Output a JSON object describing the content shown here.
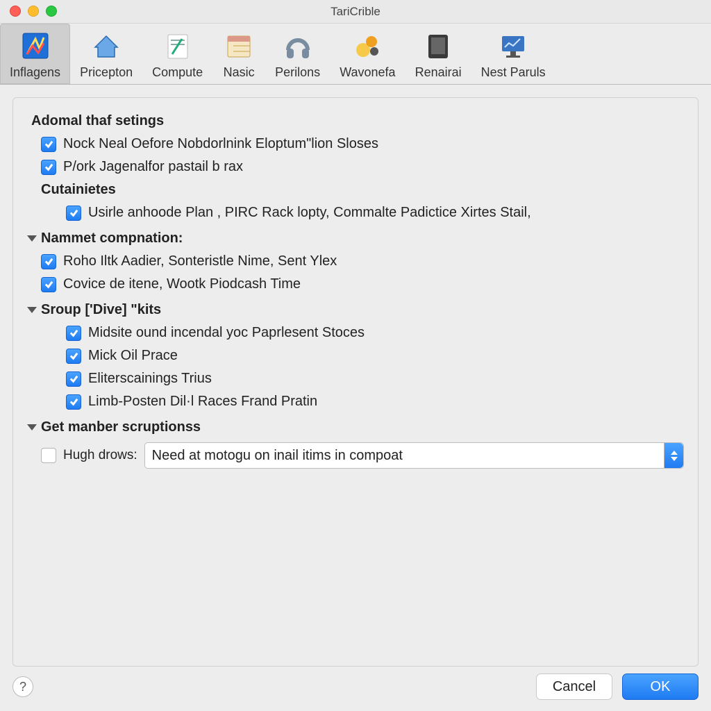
{
  "window": {
    "title": "TariCrible"
  },
  "toolbar": {
    "tabs": [
      {
        "label": "Inflagens",
        "selected": true,
        "icon": "paint-icon"
      },
      {
        "label": "Pricepton",
        "selected": false,
        "icon": "house-icon"
      },
      {
        "label": "Compute",
        "selected": false,
        "icon": "note-icon"
      },
      {
        "label": "Nasic",
        "selected": false,
        "icon": "calendar-icon"
      },
      {
        "label": "Perilons",
        "selected": false,
        "icon": "headset-icon"
      },
      {
        "label": "Wavonefa",
        "selected": false,
        "icon": "colorballs-icon"
      },
      {
        "label": "Renairai",
        "selected": false,
        "icon": "tablet-icon"
      },
      {
        "label": "Nest Paruls",
        "selected": false,
        "icon": "monitor-icon"
      }
    ]
  },
  "sections": {
    "adomal": {
      "title": "Adomal thaf setings",
      "items": [
        {
          "label": "Nock Neal Oefore Nobdorlnink Eloptum\"lion Sloses",
          "checked": true
        },
        {
          "label": "P/ork Jagenalfor pastail b rax",
          "checked": true
        }
      ]
    },
    "cutainietes": {
      "title": "Cutainietes",
      "items": [
        {
          "label": "Usirle anhoode Plan , PIRC Rack lopty, Commalte Padictice Xirtes Stail,",
          "checked": true
        }
      ]
    },
    "nammet": {
      "title": "Nammet compnation:",
      "items": [
        {
          "label": "Roho Iltk Aadier, Sonteristle Nime, Sent Ylex",
          "checked": true
        },
        {
          "label": "Covice de itene, Wootk Piodcash Time",
          "checked": true
        }
      ]
    },
    "sroup": {
      "title": "Sroup ['Dive] \"kits",
      "items": [
        {
          "label": "Midsite ound incendal yoc Paprlesent Stoces",
          "checked": true
        },
        {
          "label": "Mick Oil Prace",
          "checked": true
        },
        {
          "label": "Eliterscainings Trius",
          "checked": true
        },
        {
          "label": "Limb-Posten Dil·l Races Frand Pratin",
          "checked": true
        }
      ]
    },
    "getmanber": {
      "title": "Get manber scruptionss",
      "dropdown": {
        "label": "Hugh drows:",
        "checked": false,
        "value": "Need at motogu on inail itims in compoat"
      }
    }
  },
  "footer": {
    "help": "?",
    "cancel": "Cancel",
    "ok": "OK"
  }
}
